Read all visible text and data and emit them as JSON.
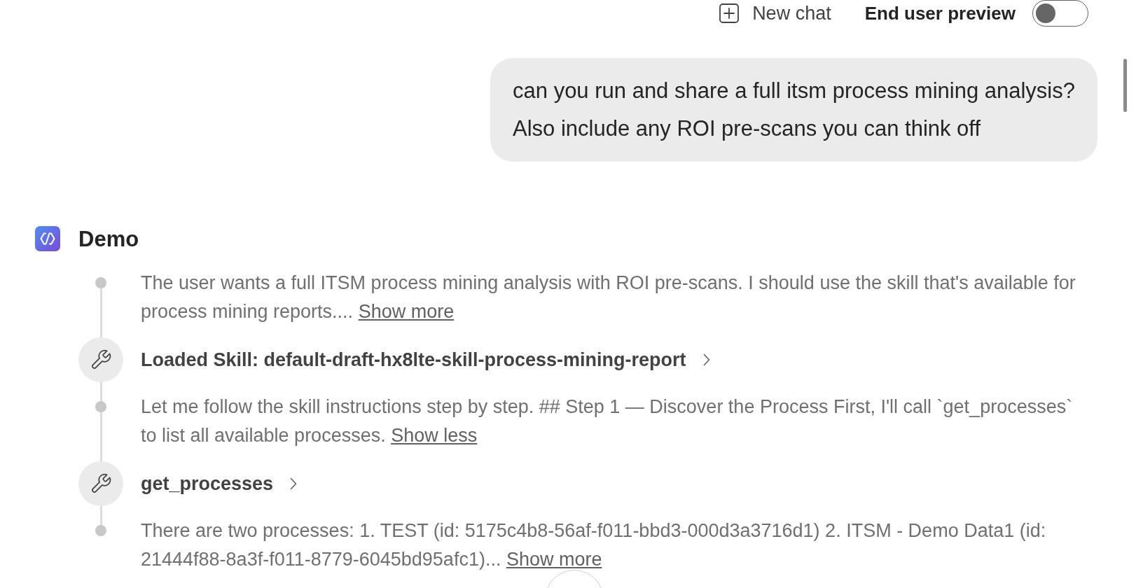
{
  "header": {
    "new_chat": {
      "label": "New chat"
    },
    "end_user_preview": {
      "label": "End user preview",
      "on": false
    }
  },
  "conversation": {
    "user_message": {
      "text": "can you run and share a full itsm process mining analysis?\nAlso include any ROI pre-scans you can think off"
    },
    "agent": {
      "name": "Demo",
      "steps": [
        {
          "kind": "thought",
          "text": "The user wants a full ITSM process mining analysis with ROI pre-scans. I should use the skill that's available for process mining reports....",
          "link": "Show more"
        },
        {
          "kind": "tool",
          "label": "Loaded Skill: default-draft-hx8lte-skill-process-mining-report"
        },
        {
          "kind": "thought",
          "text": "Let me follow the skill instructions step by step. ## Step 1 — Discover the Process First, I'll call `get_processes` to list all available processes.",
          "link": "Show less"
        },
        {
          "kind": "tool",
          "label": "get_processes"
        },
        {
          "kind": "thought",
          "text": "There are two processes: 1. TEST (id: 5175c4b8-56af-f011-bbd3-000d3a3716d1) 2. ITSM - Demo Data1 (id: 21444f88-8a3f-f011-8779-6045bd95afc1)...",
          "link": "Show more"
        }
      ]
    }
  }
}
